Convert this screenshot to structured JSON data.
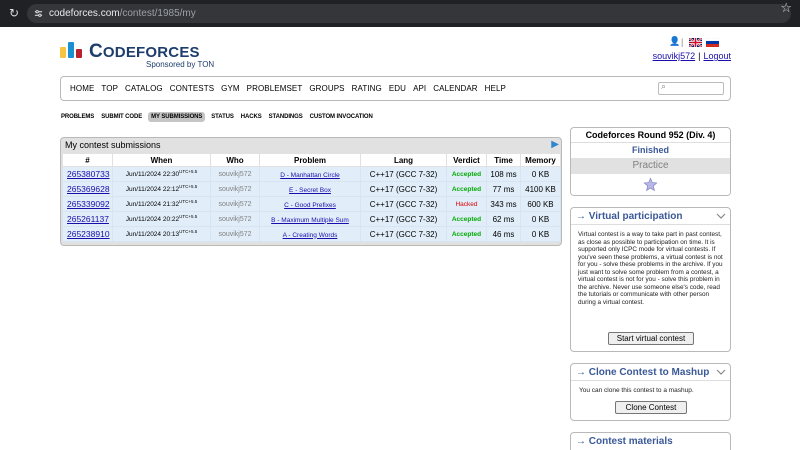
{
  "browser": {
    "url_host": "codeforces.com",
    "url_path": "/contest/1985/my"
  },
  "header": {
    "logo_code": "C",
    "logo_ode": "ODE",
    "logo_forces": "FORCES",
    "sponsor": "Sponsored by TON",
    "username": "souvikj572",
    "logout": "Logout"
  },
  "menu": [
    "HOME",
    "TOP",
    "CATALOG",
    "CONTESTS",
    "GYM",
    "PROBLEMSET",
    "GROUPS",
    "RATING",
    "EDU",
    "API",
    "CALENDAR",
    "HELP"
  ],
  "submenu": [
    "PROBLEMS",
    "SUBMIT CODE",
    "MY SUBMISSIONS",
    "STATUS",
    "HACKS",
    "STANDINGS",
    "CUSTOM INVOCATION"
  ],
  "submenu_active": "MY SUBMISSIONS",
  "submissions": {
    "title": "My contest submissions",
    "columns": [
      "#",
      "When",
      "Who",
      "Problem",
      "Lang",
      "Verdict",
      "Time",
      "Memory"
    ],
    "rows": [
      {
        "id": "265380733",
        "when": "Jun/11/2024 22:30",
        "tz": "UTC+5.5",
        "who": "souvikj572",
        "problem": "D - Manhattan Circle",
        "lang": "C++17 (GCC 7-32)",
        "verdict": "Accepted",
        "time": "108 ms",
        "memory": "0 KB"
      },
      {
        "id": "265369628",
        "when": "Jun/11/2024 22:12",
        "tz": "UTC+5.5",
        "who": "souvikj572",
        "problem": "E - Secret Box",
        "lang": "C++17 (GCC 7-32)",
        "verdict": "Accepted",
        "time": "77 ms",
        "memory": "4100 KB"
      },
      {
        "id": "265339092",
        "when": "Jun/11/2024 21:32",
        "tz": "UTC+5.5",
        "who": "souvikj572",
        "problem": "C - Good Prefixes",
        "lang": "C++17 (GCC 7-32)",
        "verdict": "Hacked",
        "time": "343 ms",
        "memory": "600 KB"
      },
      {
        "id": "265261137",
        "when": "Jun/11/2024 20:22",
        "tz": "UTC+5.5",
        "who": "souvikj572",
        "problem": "B - Maximum Multiple Sum",
        "lang": "C++17 (GCC 7-32)",
        "verdict": "Accepted",
        "time": "62 ms",
        "memory": "0 KB"
      },
      {
        "id": "265238910",
        "when": "Jun/11/2024 20:13",
        "tz": "UTC+5.5",
        "who": "souvikj572",
        "problem": "A - Creating Words",
        "lang": "C++17 (GCC 7-32)",
        "verdict": "Accepted",
        "time": "46 ms",
        "memory": "0 KB"
      }
    ]
  },
  "sidebar": {
    "round_name": "Codeforces Round 952 (Div. 4)",
    "round_status": "Finished",
    "practice": "Practice",
    "virtual": {
      "title": "→ Virtual participation",
      "text": "Virtual contest is a way to take part in past contest, as close as possible to participation on time. It is supported only ICPC mode for virtual contests. If you've seen these problems, a virtual contest is not for you - solve these problems in the archive. If you just want to solve some problem from a contest, a virtual contest is not for you - solve this problem in the archive. Never use someone else's code, read the tutorials or communicate with other person during a virtual contest.",
      "button": "Start virtual contest"
    },
    "mashup": {
      "title": "→ Clone Contest to Mashup",
      "text": "You can clone this contest to a mashup.",
      "button": "Clone Contest"
    },
    "materials": {
      "title": "→ Contest materials"
    }
  },
  "colors": {
    "accepted": "#00aa00",
    "hacked": "#dd0000",
    "link": "#1a0dab",
    "sidebar_heading": "#3b5998"
  }
}
